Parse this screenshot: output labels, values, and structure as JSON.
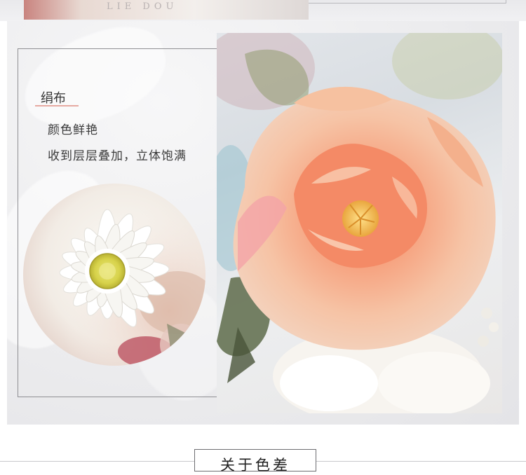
{
  "top_photo_text": "LIE DOU",
  "section": {
    "title": "绢布",
    "line1": "颜色鲜艳",
    "line2": "收到层层叠加，立体饱满"
  },
  "next_heading": "关于色差",
  "colors": {
    "accent_underline": "#e6a9a1",
    "frame_border": "#8f8f93",
    "panel_bg": "#ececee"
  },
  "images": {
    "daisy": "white-daisy-photo",
    "peony": "peach-peony-photo"
  }
}
